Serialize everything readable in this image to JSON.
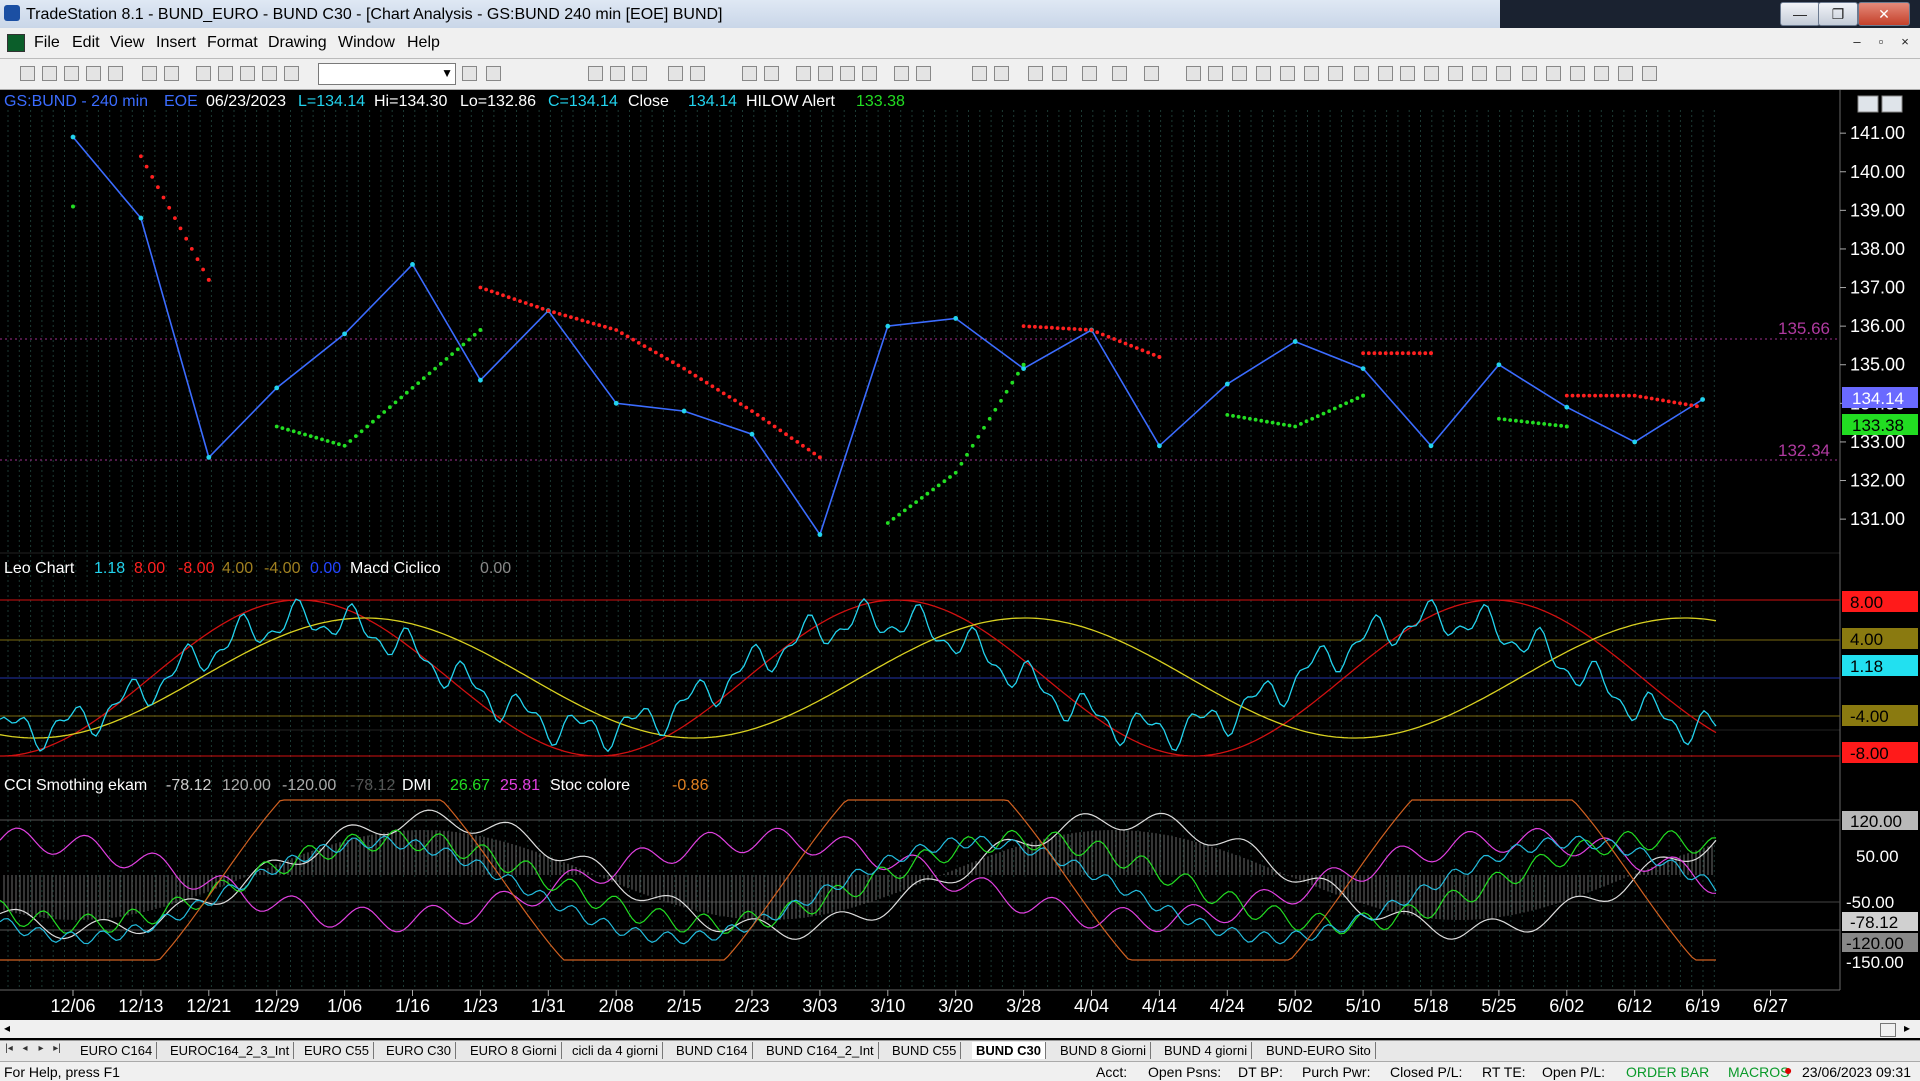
{
  "window": {
    "title": "TradeStation 8.1 - BUND_EURO - BUND  C30 - [Chart Analysis - GS:BUND  240 min  [EOE] BUND]",
    "minimize": "—",
    "restore": "❐",
    "close": "✕"
  },
  "menu": [
    "File",
    "Edit",
    "View",
    "Insert",
    "Format",
    "Drawing",
    "Window",
    "Help"
  ],
  "mdi": {
    "minimize": "–",
    "restore": "▫",
    "close": "×"
  },
  "price_header": {
    "symbol": "GS:BUND - 240 min",
    "session": "EOE",
    "date": "06/23/2023",
    "last": "L=134.14",
    "hi": "Hi=134.30",
    "lo": "Lo=132.86",
    "close_val": "C=134.14",
    "close_label": "Close",
    "close_num": "134.14",
    "hilow_label": "HILOW Alert",
    "hilow_val": "133.38"
  },
  "leo_header": {
    "name": "Leo Chart",
    "v1": "1.18",
    "v2": "8.00",
    "v3": "-8.00",
    "v4": "4.00",
    "v5": "-4.00",
    "v6": "0.00",
    "macd_name": "Macd Ciclico",
    "macd_val": "0.00"
  },
  "cci_header": {
    "name": "CCI Smothing ekam",
    "v1": "-78.12",
    "v2": "120.00",
    "v3": "-120.00",
    "v4": "-78.12",
    "dmi_name": "DMI",
    "dmi1": "26.67",
    "dmi2": "25.81",
    "stoc_name": "Stoc colore",
    "stoc_val": "-0.86"
  },
  "price_axis": [
    "141.00",
    "140.00",
    "139.00",
    "138.00",
    "137.00",
    "136.00",
    "135.00",
    "134.00",
    "133.00",
    "132.00",
    "131.00"
  ],
  "price_markers": {
    "upper": "135.66",
    "lower": "132.34"
  },
  "price_badges": {
    "last": "134.14",
    "alert": "133.38"
  },
  "leo_axis": {
    "p8": "8.00",
    "p4": "4.00",
    "cur": "1.18",
    "n4": "-4.00",
    "n8": "-8.00"
  },
  "cci_axis": {
    "p120": "120.00",
    "p50": "50.00",
    "n50": "-50.00",
    "cur": "-78.12",
    "n120": "-120.00",
    "n150": "-150.00"
  },
  "x_dates": [
    "12/06",
    "12/13",
    "12/21",
    "12/29",
    "1/06",
    "1/16",
    "1/23",
    "1/31",
    "2/08",
    "2/15",
    "2/23",
    "3/03",
    "3/10",
    "3/20",
    "3/28",
    "4/04",
    "4/14",
    "4/24",
    "5/02",
    "5/10",
    "5/18",
    "5/25",
    "6/02",
    "6/12",
    "6/19",
    "6/27"
  ],
  "chart_data": {
    "type": "line",
    "title": "GS:BUND - 240 min",
    "x": [
      "12/06",
      "12/13",
      "12/21",
      "12/29",
      "1/06",
      "1/16",
      "1/23",
      "1/31",
      "2/08",
      "2/15",
      "2/23",
      "3/03",
      "3/10",
      "3/20",
      "3/28",
      "4/04",
      "4/14",
      "4/24",
      "5/02",
      "5/10",
      "5/18",
      "5/25",
      "6/02",
      "6/12",
      "6/19"
    ],
    "ylim": [
      130.2,
      141.6
    ],
    "grid": true,
    "legend": "top-left",
    "series": [
      {
        "name": "",
        "color": "#22d3ee",
        "values": [
          140.9,
          138.8,
          132.6,
          134.4,
          135.8,
          137.6,
          134.6,
          136.4,
          134.0,
          133.8,
          133.2,
          130.6,
          136.0,
          136.2,
          134.9,
          135.9,
          132.9,
          134.5,
          135.6,
          134.9,
          132.9,
          135.0,
          133.9,
          133.0,
          134.1
        ]
      },
      {
        "name": "",
        "color": "#ff2020",
        "values": [
          null,
          140.4,
          137.2,
          null,
          null,
          null,
          137.0,
          136.4,
          135.9,
          134.9,
          133.8,
          132.6,
          null,
          null,
          136.0,
          135.9,
          135.2,
          null,
          null,
          135.3,
          135.3,
          null,
          134.2,
          134.2,
          133.9
        ]
      },
      {
        "name": "",
        "color": "#22dd22",
        "values": [
          139.1,
          null,
          null,
          133.4,
          132.9,
          134.4,
          135.9,
          null,
          null,
          null,
          null,
          null,
          130.9,
          132.2,
          135.0,
          null,
          null,
          133.7,
          133.4,
          134.2,
          null,
          133.6,
          133.4,
          null,
          null
        ]
      }
    ]
  }
}
